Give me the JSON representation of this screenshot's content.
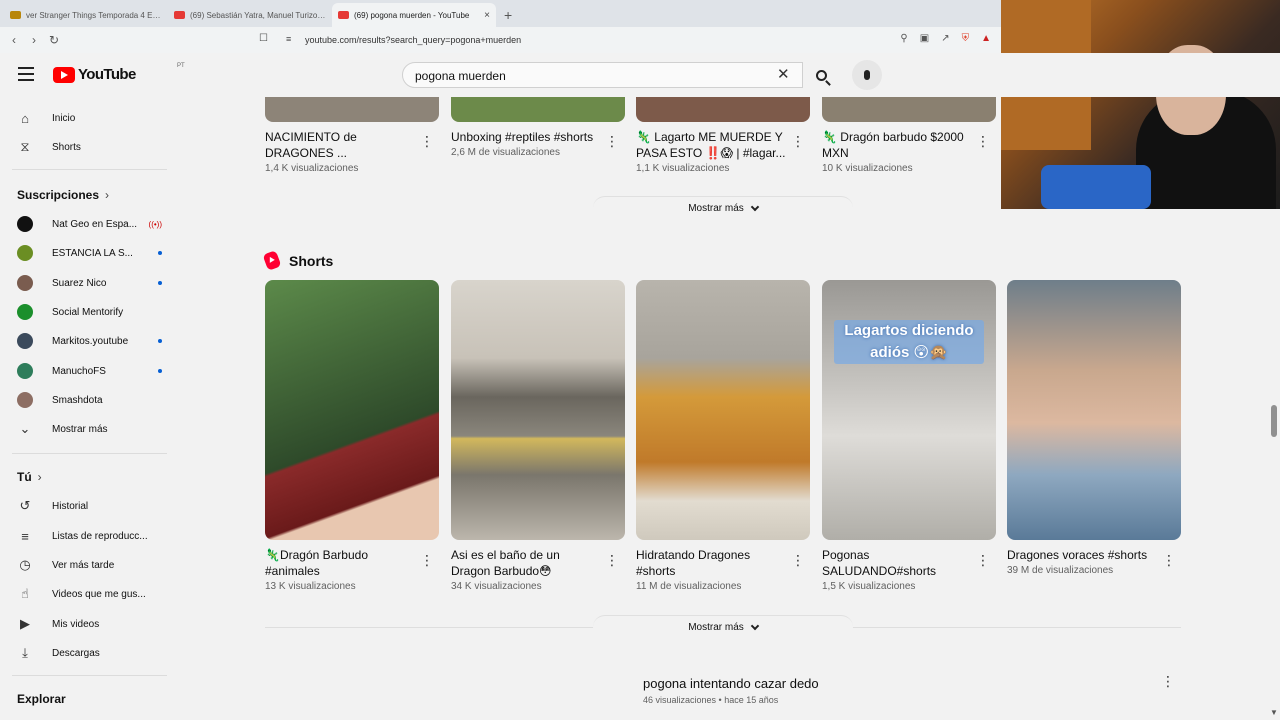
{
  "browser": {
    "tabs": [
      {
        "label": "ver Stranger Things Temporada 4 Ep..."
      },
      {
        "label": "(69) Sebastián Yatra, Manuel Turizo, I..."
      },
      {
        "label": "(69) pogona muerden - YouTube",
        "close": "×"
      }
    ],
    "new_tab": "+",
    "url": "youtube.com/results?search_query=pogona+muerden"
  },
  "header": {
    "logo": "YouTube",
    "country_code": "PT",
    "search_value": "pogona muerden",
    "clear": "✕"
  },
  "sidebar": {
    "main": [
      {
        "label": "Inicio",
        "icon": "home-icon"
      },
      {
        "label": "Shorts",
        "icon": "shorts-icon"
      }
    ],
    "subscriptions_title": "Suscripciones",
    "subscriptions": [
      {
        "label": "Nat Geo en Espa...",
        "indicator": "live",
        "live_glyph": "((•))",
        "color": "#111111"
      },
      {
        "label": "ESTANCIA LA S...",
        "indicator": "dot",
        "color": "#6b8e23"
      },
      {
        "label": "Suarez Nico",
        "indicator": "dot",
        "color": "#7a5c4f"
      },
      {
        "label": "Social Mentorify",
        "indicator": "",
        "color": "#1b8f2c"
      },
      {
        "label": "Markitos.youtube",
        "indicator": "dot",
        "color": "#3b4a5c"
      },
      {
        "label": "ManuchoFS",
        "indicator": "dot",
        "color": "#2e7d5b"
      },
      {
        "label": "Smashdota",
        "indicator": "",
        "color": "#8d6e63"
      }
    ],
    "show_more": "Mostrar más",
    "you_title": "Tú",
    "you": [
      {
        "label": "Historial",
        "icon": "history-icon"
      },
      {
        "label": "Listas de reproducc...",
        "icon": "playlist-icon"
      },
      {
        "label": "Ver más tarde",
        "icon": "clock-icon"
      },
      {
        "label": "Videos que me gus...",
        "icon": "thumbs-up-icon"
      },
      {
        "label": "Mis videos",
        "icon": "my-videos-icon"
      },
      {
        "label": "Descargas",
        "icon": "download-icon"
      }
    ],
    "explore_title": "Explorar"
  },
  "top_videos": [
    {
      "title": "NACIMIENTO de DRAGONES ...",
      "meta": "1,4 K visualizaciones",
      "thumb": "#8d8478"
    },
    {
      "title": "Unboxing #reptiles #shorts",
      "meta": "2,6 M de visualizaciones",
      "thumb": "#6c8a4a"
    },
    {
      "title": "🦎 Lagarto ME MUERDE Y PASA ESTO ‼️😱 | #lagar...",
      "meta": "1,1 K visualizaciones",
      "thumb": "#7d5a4a"
    },
    {
      "title": "🦎 Dragón barbudo $2000 MXN",
      "meta": "10 K visualizaciones",
      "thumb": "#8a8070"
    }
  ],
  "show_more": "Mostrar más",
  "shorts": {
    "title": "Shorts",
    "items": [
      {
        "title": "🦎Dragón Barbudo #animales",
        "meta": "13 K visualizaciones",
        "bg": "#3f6b3a"
      },
      {
        "title": "Asi es el baño de un Dragon Barbudo😳",
        "meta": "34 K visualizaciones",
        "bg": "#9c9487"
      },
      {
        "title": "Hidratando Dragones #shorts",
        "meta": "11 M de visualizaciones",
        "bg": "#c5a25a"
      },
      {
        "title": "Pogonas SALUDANDO#shorts",
        "meta": "1,5 K visualizaciones",
        "bg": "#a9a7a3",
        "overlay": "Lagartos diciendo adiós 😲🙊"
      },
      {
        "title": "Dragones voraces #shorts",
        "meta": "39 M de visualizaciones",
        "bg": "#8ea0b0"
      }
    ]
  },
  "bottom_video": {
    "title": "pogona intentando cazar dedo",
    "meta": "46 visualizaciones • hace 15 años"
  }
}
